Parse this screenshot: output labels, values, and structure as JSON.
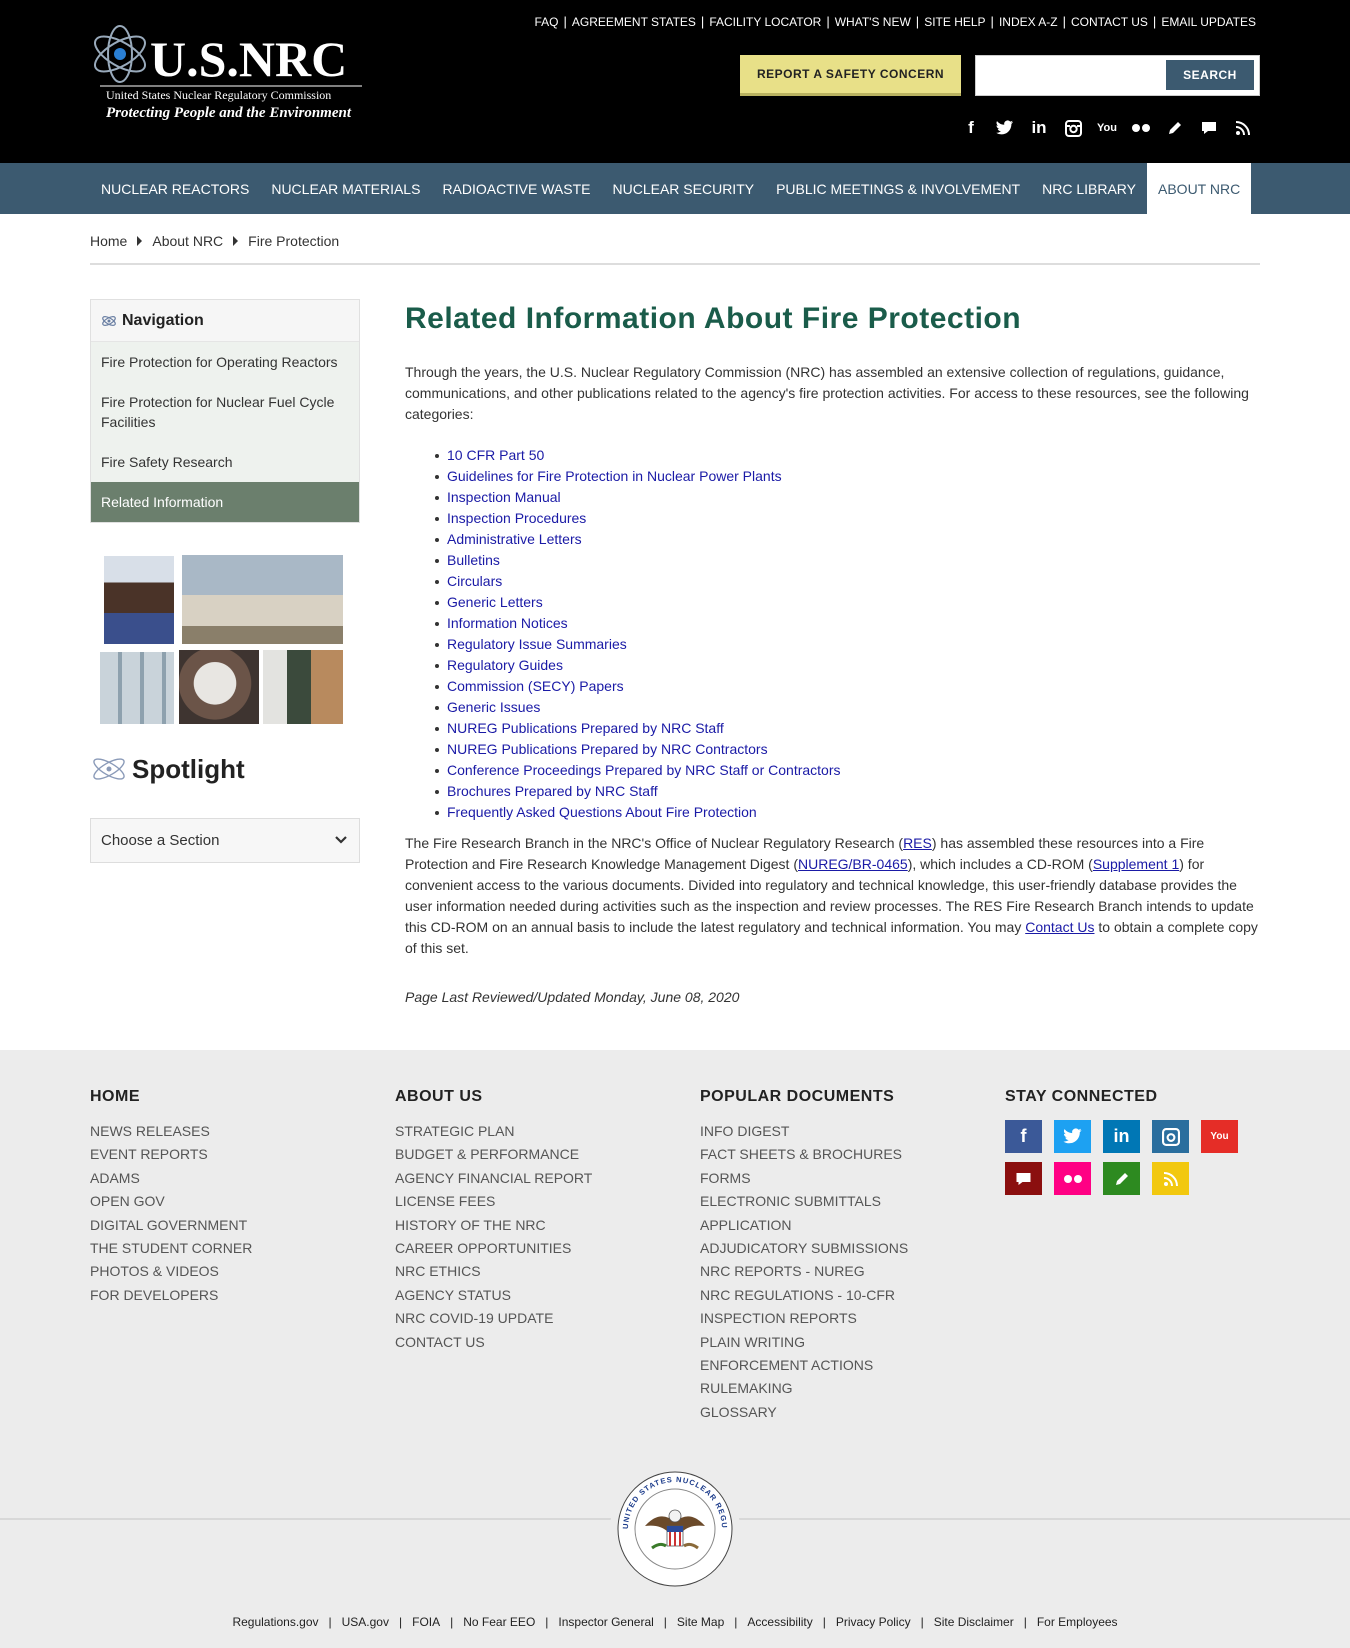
{
  "header": {
    "logo_text": "U.S.NRC",
    "logo_subtitle": "United States Nuclear Regulatory Commission",
    "logo_tagline": "Protecting People and the Environment",
    "top_links": [
      "FAQ",
      "AGREEMENT STATES",
      "FACILITY LOCATOR",
      "WHAT'S NEW",
      "SITE HELP",
      "INDEX A-Z",
      "CONTACT US",
      "EMAIL UPDATES"
    ],
    "report_button": "REPORT A SAFETY CONCERN",
    "search_placeholder": "",
    "search_button": "SEARCH",
    "social_icons": [
      "facebook-icon",
      "twitter-icon",
      "linkedin-icon",
      "instagram-icon",
      "youtube-icon",
      "flickr-icon",
      "pencil-icon",
      "comment-icon",
      "rss-icon"
    ]
  },
  "mainnav": [
    "NUCLEAR REACTORS",
    "NUCLEAR MATERIALS",
    "RADIOACTIVE WASTE",
    "NUCLEAR SECURITY",
    "PUBLIC MEETINGS & INVOLVEMENT",
    "NRC LIBRARY",
    "ABOUT NRC"
  ],
  "breadcrumb": [
    "Home",
    "About NRC",
    "Fire Protection"
  ],
  "sidebar": {
    "nav_title": "Navigation",
    "items": [
      "Fire Protection for Operating Reactors",
      "Fire Protection for Nuclear Fuel Cycle Facilities",
      "Fire Safety Research",
      "Related Information"
    ],
    "spotlight_title": "Spotlight",
    "choose_section": "Choose a Section"
  },
  "content": {
    "title": "Related Information About Fire Protection",
    "intro": "Through the years, the U.S. Nuclear Regulatory Commission (NRC) has assembled an extensive collection of regulations, guidance, communications, and other publications related to the agency's fire protection activities. For access to these resources, see the following categories:",
    "categories": [
      "10 CFR Part 50",
      "Guidelines for Fire Protection in Nuclear Power Plants",
      "Inspection Manual",
      "Inspection Procedures",
      "Administrative Letters",
      "Bulletins",
      "Circulars",
      "Generic Letters",
      "Information Notices",
      "Regulatory Issue Summaries",
      "Regulatory Guides",
      "Commission (SECY) Papers",
      "Generic Issues",
      "NUREG Publications Prepared by NRC Staff",
      "NUREG Publications Prepared by NRC Contractors",
      "Conference Proceedings Prepared by NRC Staff or Contractors",
      "Brochures Prepared by NRC Staff",
      "Frequently Asked Questions About Fire Protection"
    ],
    "body_p1": "The Fire Research Branch in the NRC's Office of Nuclear Regulatory Research (",
    "body_link_res": "RES",
    "body_p2": ") has assembled these resources into a Fire Protection and Fire Research Knowledge Management Digest (",
    "body_link_nureg": "NUREG/BR-0465",
    "body_p3": "), which includes a CD-ROM (",
    "body_link_supp": "Supplement 1",
    "body_p4": ") for convenient access to the various documents. Divided into regulatory and technical knowledge, this user-friendly database provides the user information needed during activities such as the inspection and review processes. The RES Fire Research Branch intends to update this CD-ROM on an annual basis to include the latest regulatory and technical information. You may ",
    "body_link_contact": "Contact Us",
    "body_p5": " to obtain a complete copy of this set.",
    "updated": "Page Last Reviewed/Updated Monday, June 08, 2020"
  },
  "footer": {
    "col1": {
      "title": "HOME",
      "items": [
        "NEWS RELEASES",
        "EVENT REPORTS",
        "ADAMS",
        "OPEN GOV",
        "DIGITAL GOVERNMENT",
        "THE STUDENT CORNER",
        "PHOTOS & VIDEOS",
        "FOR DEVELOPERS"
      ]
    },
    "col2": {
      "title": "ABOUT US",
      "items": [
        "STRATEGIC PLAN",
        "BUDGET & PERFORMANCE",
        "AGENCY FINANCIAL REPORT",
        "LICENSE FEES",
        "HISTORY OF THE NRC",
        "CAREER OPPORTUNITIES",
        "NRC ETHICS",
        "AGENCY STATUS",
        "NRC COVID-19 UPDATE",
        "CONTACT US"
      ]
    },
    "col3": {
      "title": "POPULAR DOCUMENTS",
      "items": [
        "INFO DIGEST",
        "FACT SHEETS & BROCHURES",
        "FORMS",
        "ELECTRONIC SUBMITTALS",
        "APPLICATION",
        "ADJUDICATORY SUBMISSIONS",
        "NRC REPORTS - NUREG",
        "NRC REGULATIONS - 10-CFR",
        "INSPECTION REPORTS",
        "PLAIN WRITING",
        "ENFORCEMENT ACTIONS",
        "RULEMAKING",
        "GLOSSARY"
      ]
    },
    "col4": {
      "title": "STAY CONNECTED"
    },
    "social": [
      {
        "name": "facebook-icon",
        "color": "#3b5998"
      },
      {
        "name": "twitter-icon",
        "color": "#1da1f2"
      },
      {
        "name": "linkedin-icon",
        "color": "#0077b5"
      },
      {
        "name": "instagram-icon",
        "color": "#2a6e9e"
      },
      {
        "name": "youtube-icon",
        "color": "#e52d27"
      },
      {
        "name": "comment-icon",
        "color": "#8b0f0f"
      },
      {
        "name": "flickr-icon",
        "color": "#ff0084"
      },
      {
        "name": "pencil-icon",
        "color": "#2d8a20"
      },
      {
        "name": "rss-icon",
        "color": "#f2c80f"
      }
    ],
    "seal_text": "UNITED STATES NUCLEAR REGULATORY COMMISSION",
    "bottom_links": [
      "Regulations.gov",
      "USA.gov",
      "FOIA",
      "No Fear EEO",
      "Inspector General",
      "Site Map",
      "Accessibility",
      "Privacy Policy",
      "Site Disclaimer",
      "For Employees"
    ]
  }
}
